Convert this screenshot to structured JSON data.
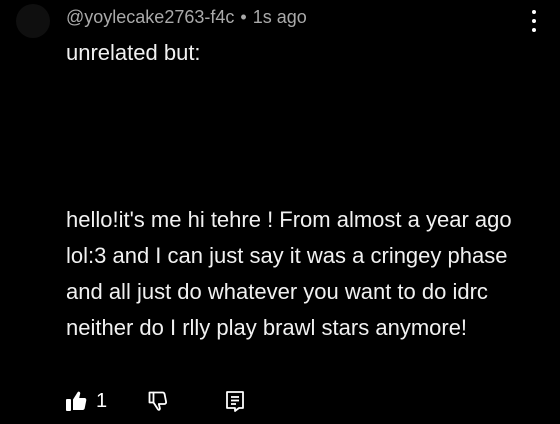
{
  "comment": {
    "author": "@yoylecake2763-f4c",
    "separator": "•",
    "time": "1s ago",
    "first_line": "unrelated but:",
    "body": "hello!it's me hi tehre ! From almost a year ago lol:3 and I can just say it was a cringey phase and all just do whatever you want to do idrc neither do I rlly play brawl stars anymore!",
    "like_count": "1"
  },
  "icons": {
    "like": "thumbs-up-filled-icon",
    "dislike": "thumbs-down-outline-icon",
    "reply": "comment-reply-icon",
    "menu": "more-vertical-icon"
  },
  "colors": {
    "background": "#000000",
    "text": "#f1f1f1",
    "meta": "#aaaaaa"
  }
}
